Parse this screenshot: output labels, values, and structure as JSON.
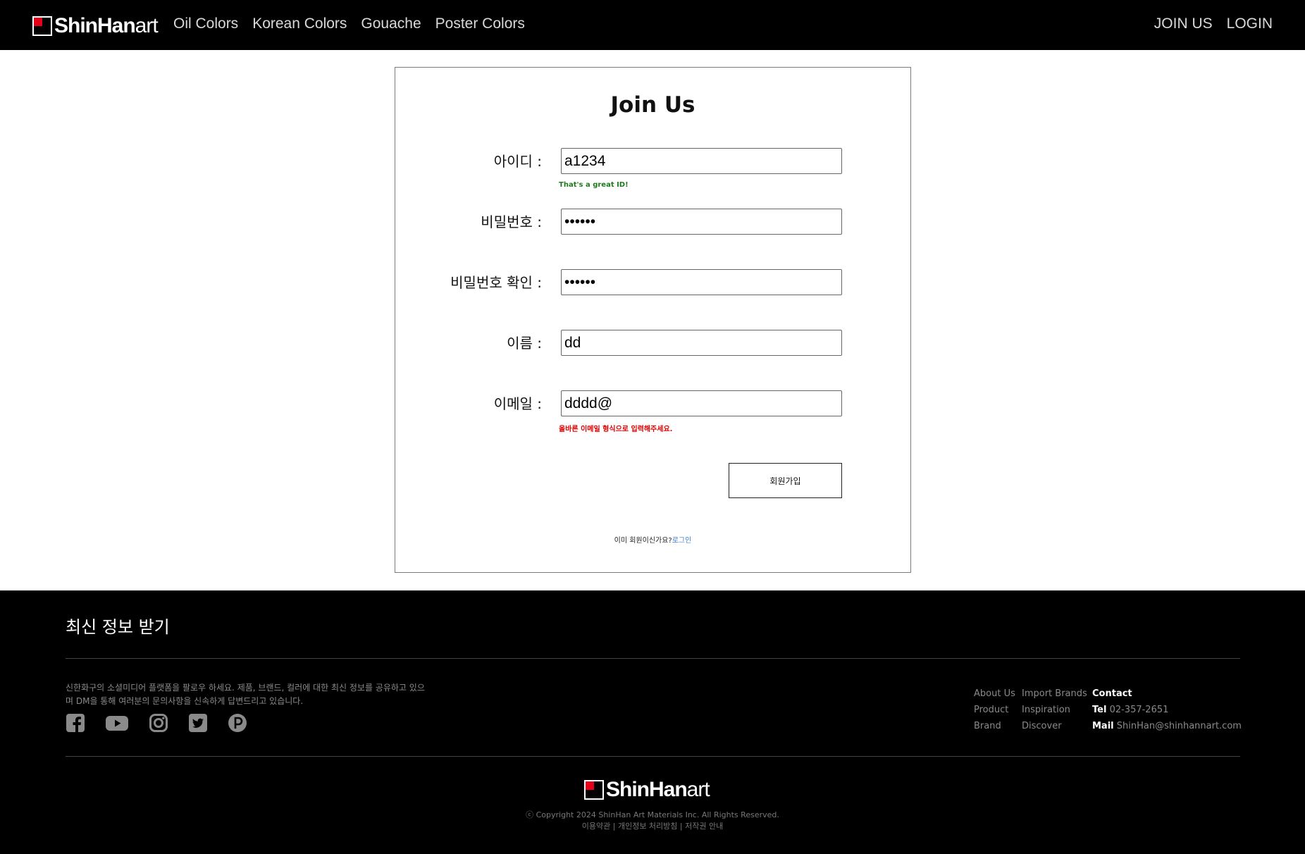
{
  "header": {
    "logo_bold": "ShinHan",
    "logo_light": "art",
    "nav": [
      "Oil Colors",
      "Korean Colors",
      "Gouache",
      "Poster Colors"
    ],
    "auth": [
      "JOIN US",
      "LOGIN"
    ]
  },
  "form": {
    "title": "Join Us",
    "fields": [
      {
        "label": "아이디 :",
        "value": "a1234",
        "message": "That's a great ID!"
      },
      {
        "label": "비밀번호 :",
        "value": "••••••"
      },
      {
        "label": "비밀번호 확인 :",
        "value": "••••••"
      },
      {
        "label": "이름 :",
        "value": "dd"
      },
      {
        "label": "이메일 :",
        "value": "dddd@",
        "message": "올바른 이메일 형식으로 입력해주세요."
      }
    ],
    "submit_label": "회원가입",
    "already_text": "이미 회원이신가요?",
    "login_link": "로그인"
  },
  "footer": {
    "title": "최신 정보 받기",
    "description": "신한화구의 소셜미디어 플랫폼을 팔로우 하세요. 제품, 브랜드, 컬러에 대한 최신 정보를 공유하고 있으며 DM을 통해 여러분의 문의사항을 신속하게 답변드리고 있습니다.",
    "socials": [
      "facebook-icon",
      "youtube-icon",
      "instagram-icon",
      "twitter-icon",
      "pinterest-icon"
    ],
    "links_col1": [
      "About Us",
      "Product",
      "Brand"
    ],
    "links_col2": [
      "Import Brands",
      "Inspiration",
      "Discover"
    ],
    "contact": {
      "heading": "Contact",
      "tel_label": "Tel",
      "tel": "02-357-2651",
      "mail_label": "Mail",
      "mail": "ShinHan@shinhannart.com"
    },
    "copyright": "ⓒ Copyright 2024 ShinHan Art Materials Inc. All Rights Reserved.",
    "legal": "이용약관 | 개인정보 처리방침 | 저작권 안내"
  }
}
